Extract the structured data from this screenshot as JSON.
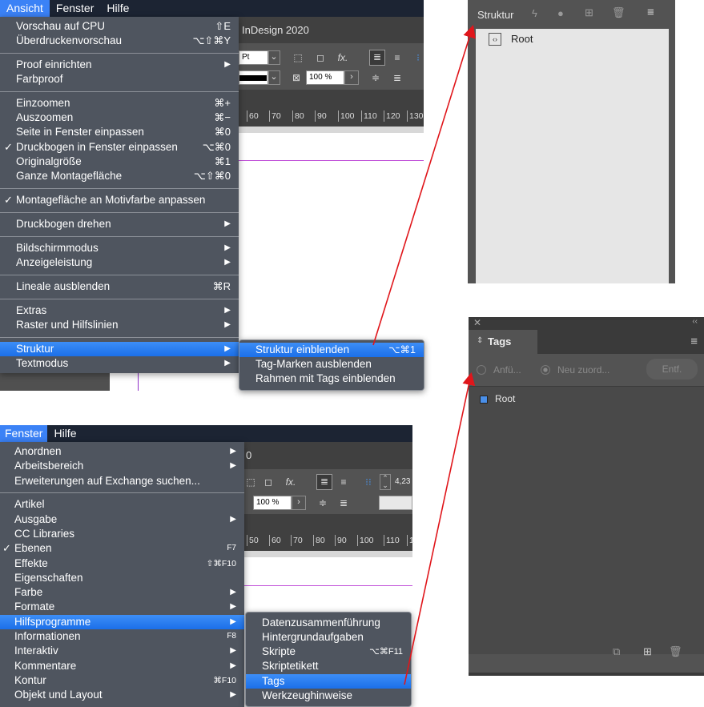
{
  "top": {
    "menubar": [
      "Ansicht",
      "Fenster",
      "Hilfe"
    ],
    "app_title": "InDesign 2020",
    "ctrl": {
      "unit": "Pt",
      "zoom": "100 %",
      "fx": "fx."
    },
    "ruler": [
      "60",
      "70",
      "80",
      "90",
      "100",
      "110",
      "120",
      "130"
    ],
    "menu_items": [
      {
        "label": "Vorschau auf CPU",
        "shortcut": "⇧E"
      },
      {
        "label": "Überdruckenvorschau",
        "shortcut": "⌥⇧⌘Y"
      },
      {
        "label": "Proof einrichten",
        "arrow": "▶"
      },
      {
        "label": "Farbproof"
      },
      {
        "label": "Einzoomen",
        "shortcut": "⌘+"
      },
      {
        "label": "Auszoomen",
        "shortcut": "⌘−"
      },
      {
        "label": "Seite in Fenster einpassen",
        "shortcut": "⌘0"
      },
      {
        "label": "Druckbogen in Fenster einpassen",
        "shortcut": "⌥⌘0",
        "check": "✓"
      },
      {
        "label": "Originalgröße",
        "shortcut": "⌘1"
      },
      {
        "label": "Ganze Montagefläche",
        "shortcut": "⌥⇧⌘0"
      },
      {
        "label": "Montagefläche an Motivfarbe anpassen",
        "check": "✓"
      },
      {
        "label": "Druckbogen drehen",
        "arrow": "▶"
      },
      {
        "label": "Bildschirmmodus",
        "arrow": "▶"
      },
      {
        "label": "Anzeigeleistung",
        "arrow": "▶"
      },
      {
        "label": "Lineale ausblenden",
        "shortcut": "⌘R"
      },
      {
        "label": "Extras",
        "arrow": "▶"
      },
      {
        "label": "Raster und Hilfslinien",
        "arrow": "▶"
      },
      {
        "label": "Struktur",
        "arrow": "▶"
      },
      {
        "label": "Textmodus",
        "arrow": "▶"
      }
    ],
    "submenu": [
      {
        "label": "Struktur einblenden",
        "shortcut": "⌥⌘1"
      },
      {
        "label": "Tag-Marken ausblenden"
      },
      {
        "label": "Rahmen mit Tags einblenden"
      }
    ]
  },
  "bottom": {
    "menubar": [
      "Fenster",
      "Hilfe"
    ],
    "app_title": "0",
    "ctrl": {
      "value": "4,23",
      "zoom": "100 %",
      "fx": "fx."
    },
    "ruler": [
      "50",
      "60",
      "70",
      "80",
      "90",
      "100",
      "110",
      "1"
    ],
    "menu_items": [
      {
        "label": "Anordnen",
        "arrow": "▶"
      },
      {
        "label": "Arbeitsbereich",
        "arrow": "▶"
      },
      {
        "label": "Erweiterungen auf Exchange suchen..."
      },
      {
        "label": "Artikel"
      },
      {
        "label": "Ausgabe",
        "arrow": "▶"
      },
      {
        "label": "CC Libraries"
      },
      {
        "label": "Ebenen",
        "shortcut": "F7",
        "check": "✓"
      },
      {
        "label": "Effekte",
        "shortcut": "⇧⌘F10"
      },
      {
        "label": "Eigenschaften"
      },
      {
        "label": "Farbe",
        "arrow": "▶"
      },
      {
        "label": "Formate",
        "arrow": "▶"
      },
      {
        "label": "Hilfsprogramme",
        "arrow": "▶"
      },
      {
        "label": "Informationen",
        "shortcut": "F8"
      },
      {
        "label": "Interaktiv",
        "arrow": "▶"
      },
      {
        "label": "Kommentare",
        "arrow": "▶"
      },
      {
        "label": "Kontur",
        "shortcut": "⌘F10"
      },
      {
        "label": "Objekt und Layout",
        "arrow": "▶"
      }
    ],
    "submenu": [
      {
        "label": "Datenzusammenführung"
      },
      {
        "label": "Hintergrundaufgaben"
      },
      {
        "label": "Skripte",
        "shortcut": "⌥⌘F11"
      },
      {
        "label": "Skriptetikett"
      },
      {
        "label": "Tags"
      },
      {
        "label": "Werkzeughinweise"
      }
    ]
  },
  "struktur_panel": {
    "title": "Struktur",
    "root": "Root"
  },
  "tags_panel": {
    "title": "Tags",
    "apply": "Anfü...",
    "reassign": "Neu zuord...",
    "remove": "Entf.",
    "root": "Root"
  },
  "colors": {
    "menubar": "#1c2433",
    "highlight": "#2f7ff0",
    "arrow": "#e0161b",
    "root_tag": "#4a8fe8"
  }
}
